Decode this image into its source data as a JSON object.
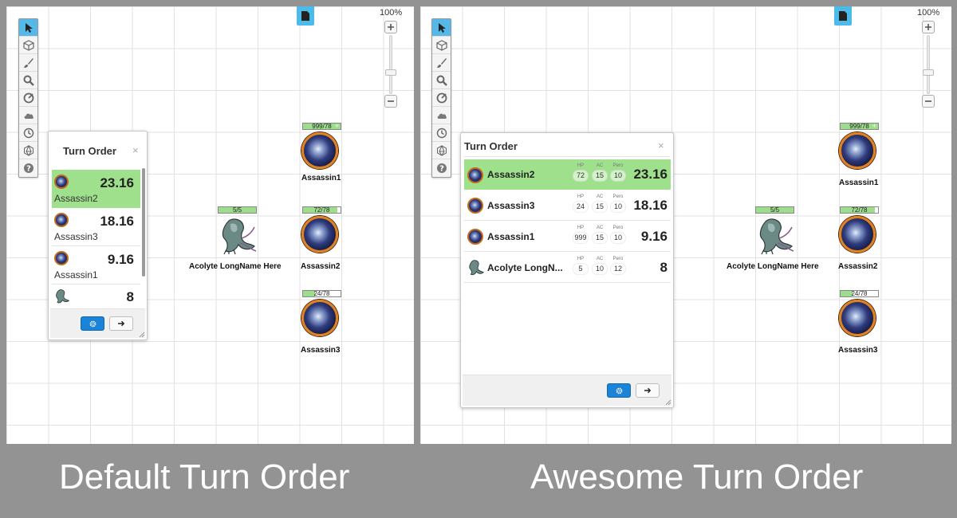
{
  "captions": {
    "left": "Default Turn Order",
    "right": "Awesome Turn Order"
  },
  "zoom": {
    "level": "100%"
  },
  "tools": [
    {
      "name": "select-tool",
      "icon": "cursor-icon"
    },
    {
      "name": "object-tool",
      "icon": "cube-icon"
    },
    {
      "name": "draw-tool",
      "icon": "brush-icon"
    },
    {
      "name": "zoom-tool",
      "icon": "magnifier-icon"
    },
    {
      "name": "measure-tool",
      "icon": "target-icon"
    },
    {
      "name": "fog-tool",
      "icon": "cloud-icon"
    },
    {
      "name": "turn-order-tool",
      "icon": "clock-icon"
    },
    {
      "name": "dice-tool",
      "icon": "d20-icon"
    },
    {
      "name": "help-tool",
      "icon": "question-icon"
    }
  ],
  "tokens": {
    "assassin1": {
      "name": "Assassin1",
      "hp": "999/78"
    },
    "assassin2": {
      "name": "Assassin2",
      "hp": "72/78"
    },
    "assassin3": {
      "name": "Assassin3",
      "hp": "24/78"
    },
    "acolyte": {
      "name": "Acolyte LongName Here",
      "hp": "5/5"
    }
  },
  "turn_order_default": {
    "title": "Turn Order",
    "close": "×",
    "entries": [
      {
        "name": "Assassin2",
        "initiative": "23.16",
        "active": true
      },
      {
        "name": "Assassin3",
        "initiative": "18.16",
        "active": false
      },
      {
        "name": "Assassin1",
        "initiative": "9.16",
        "active": false
      },
      {
        "name": "",
        "initiative": "8",
        "active": false
      }
    ]
  },
  "turn_order_awesome": {
    "title": "Turn Order",
    "close": "×",
    "stat_labels": {
      "hp": "HP",
      "ac": "AC",
      "pero": "Pero"
    },
    "entries": [
      {
        "name": "Assassin2",
        "hp": "72",
        "ac": "15",
        "pero": "10",
        "initiative": "23.16",
        "active": true
      },
      {
        "name": "Assassin3",
        "hp": "24",
        "ac": "15",
        "pero": "10",
        "initiative": "18.16",
        "active": false
      },
      {
        "name": "Assassin1",
        "hp": "999",
        "ac": "15",
        "pero": "10",
        "initiative": "9.16",
        "active": false
      },
      {
        "name": "Acolyte LongN...",
        "hp": "5",
        "ac": "10",
        "pero": "12",
        "initiative": "8",
        "active": false
      }
    ]
  },
  "colors": {
    "active_row": "#9fe08d",
    "toolbar_active": "#56b8e6",
    "gear_button": "#1b83d8",
    "hp_fill": "#9dde8d"
  }
}
